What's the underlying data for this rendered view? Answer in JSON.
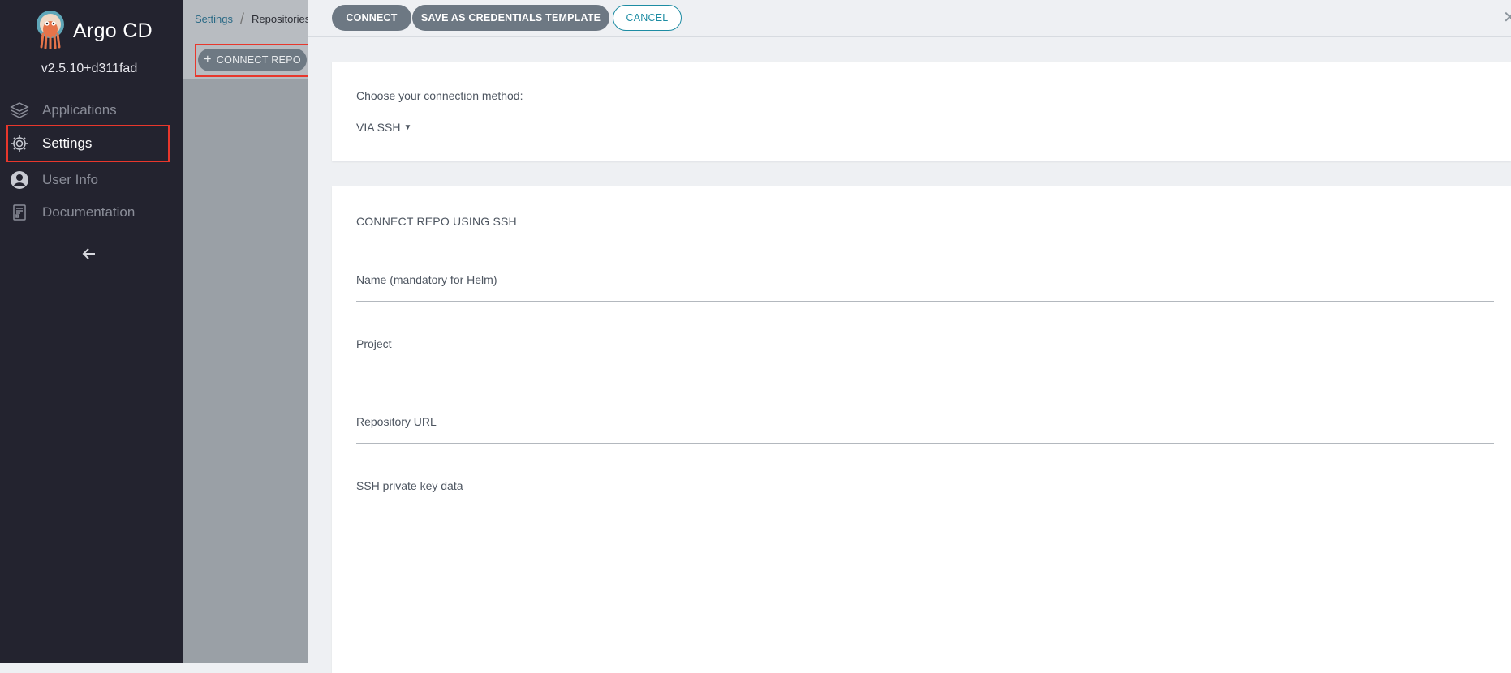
{
  "sidebar": {
    "brand": "Argo CD",
    "version": "v2.5.10+d311fad",
    "items": [
      {
        "label": "Applications",
        "icon": "layers-icon"
      },
      {
        "label": "Settings",
        "icon": "gear-icon"
      },
      {
        "label": "User Info",
        "icon": "user-circle-icon"
      },
      {
        "label": "Documentation",
        "icon": "document-icon"
      }
    ],
    "back_icon": "arrow-left-icon"
  },
  "background_page": {
    "breadcrumb": [
      "Settings",
      "Repositories"
    ],
    "connect_repo_label": "CONNECT REPO",
    "connect_repo_icon": "plus-icon"
  },
  "panel": {
    "buttons": {
      "connect": "CONNECT",
      "save_template": "SAVE AS CREDENTIALS TEMPLATE",
      "cancel": "CANCEL"
    },
    "close_icon": "close-icon",
    "method": {
      "label": "Choose your connection method:",
      "selected": "VIA SSH"
    },
    "form": {
      "title": "CONNECT REPO USING SSH",
      "fields": [
        {
          "label": "Name (mandatory for Helm)",
          "value": ""
        },
        {
          "label": "Project",
          "value": ""
        },
        {
          "label": "Repository URL",
          "value": ""
        },
        {
          "label": "SSH private key data",
          "value": ""
        }
      ]
    }
  },
  "colors": {
    "sidebar_bg": "#23232f",
    "highlight_border": "#e8372c",
    "button_dark": "#6d7883",
    "accent_teal": "#1d8ca3"
  }
}
